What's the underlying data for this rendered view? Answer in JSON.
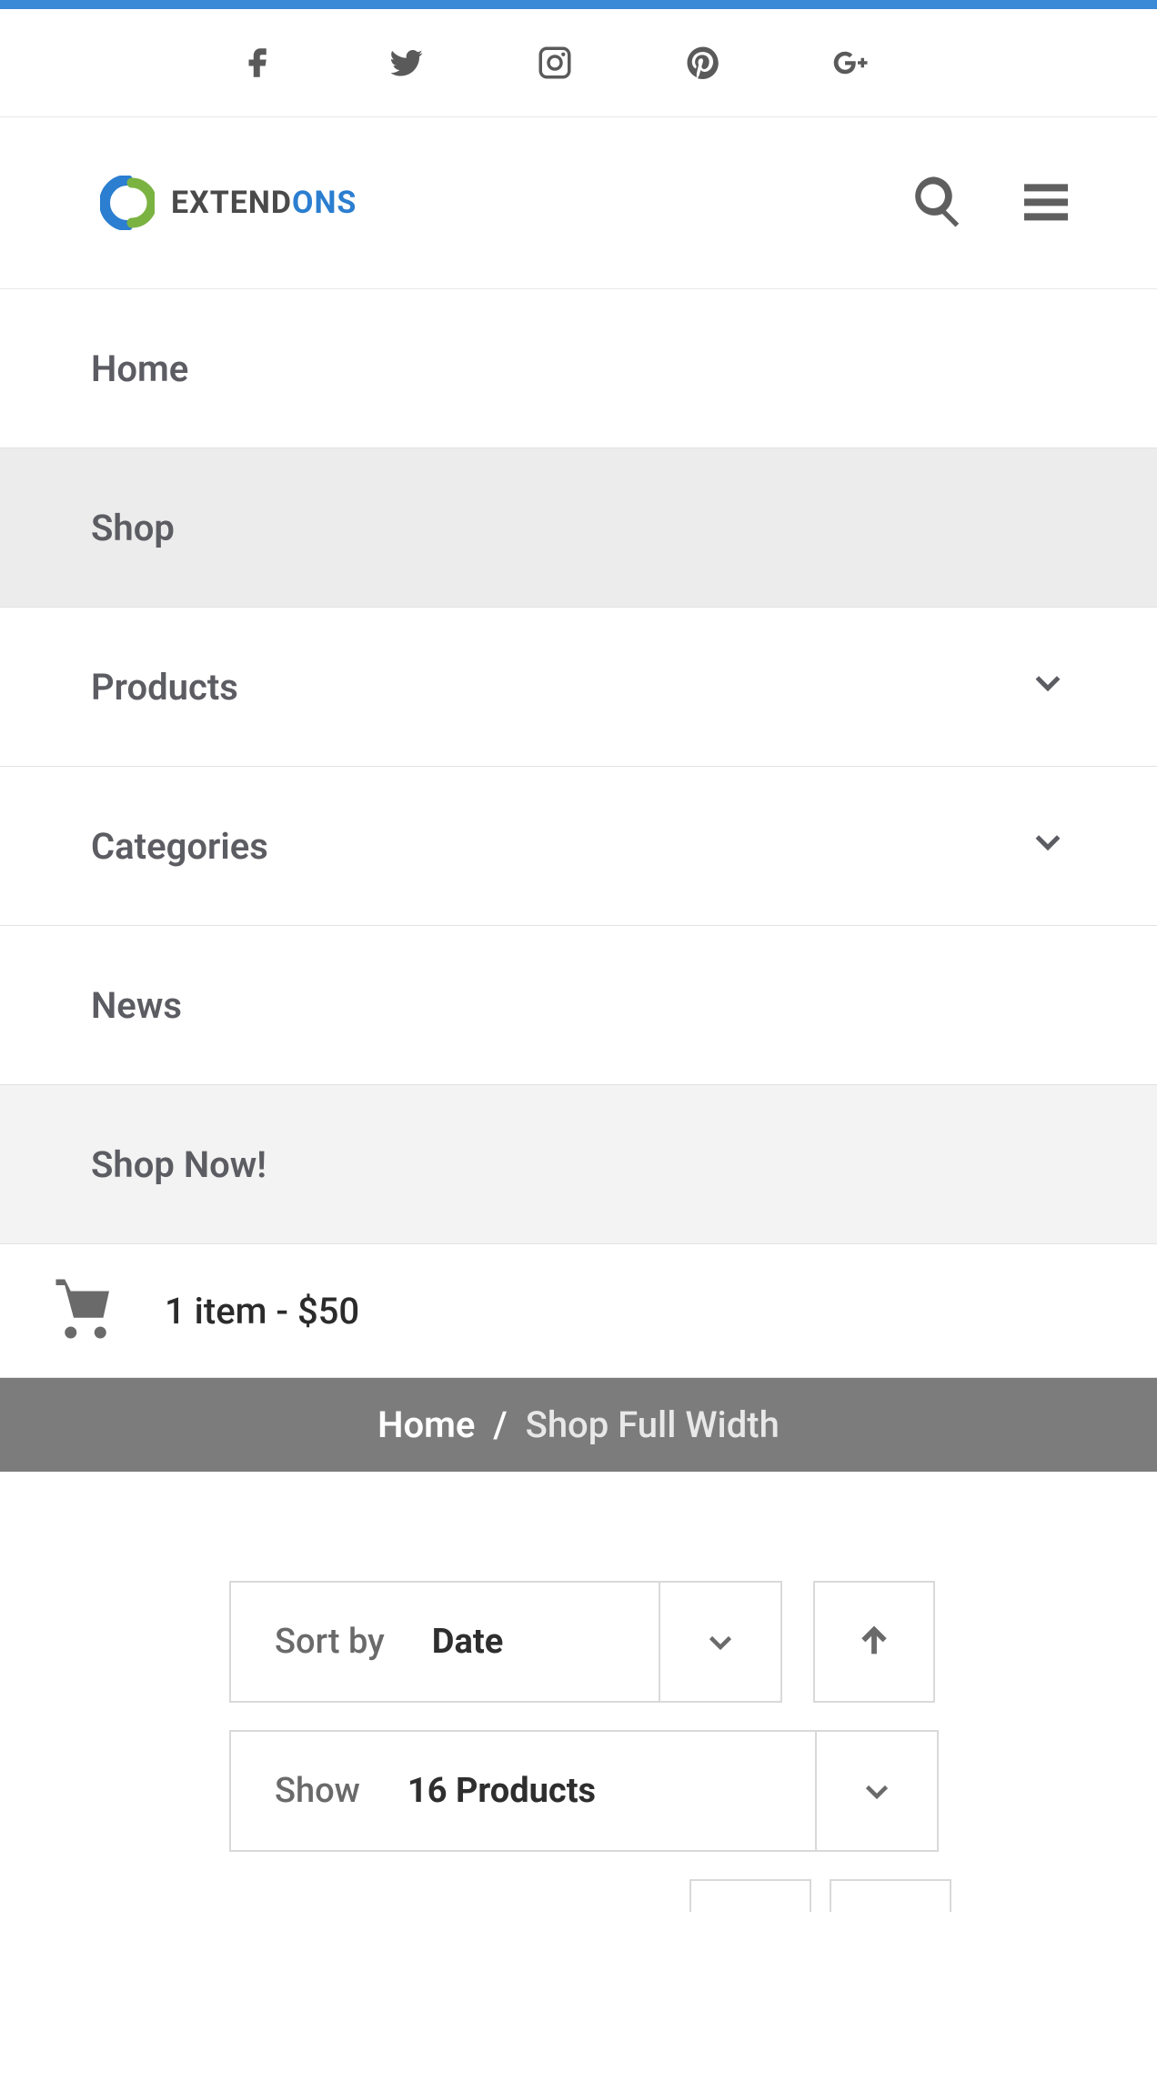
{
  "social": {
    "facebook": "facebook",
    "twitter": "twitter",
    "instagram": "instagram",
    "pinterest": "pinterest",
    "googleplus": "googleplus"
  },
  "logo": {
    "text_primary": "EXTEND",
    "text_accent": "ONS"
  },
  "nav": {
    "home": "Home",
    "shop": "Shop",
    "products": "Products",
    "categories": "Categories",
    "news": "News",
    "shopnow": "Shop Now!"
  },
  "cart": {
    "text": "1 item - $50"
  },
  "breadcrumb": {
    "home": "Home",
    "sep": "/",
    "current": "Shop Full Width"
  },
  "controls": {
    "sort_label": "Sort by",
    "sort_value": "Date",
    "show_label": "Show",
    "show_value": "16 Products"
  }
}
